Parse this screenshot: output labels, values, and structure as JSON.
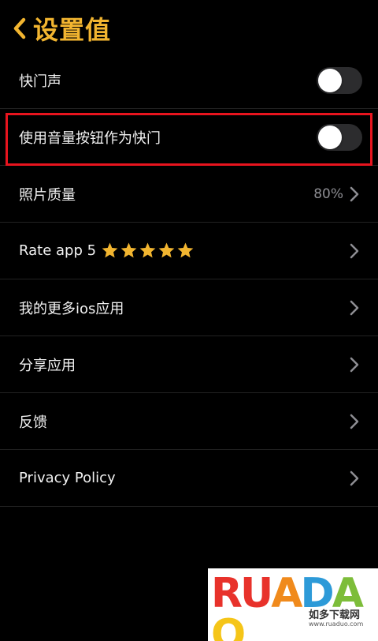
{
  "nav": {
    "title": "设置值",
    "accent_color": "#f2b530"
  },
  "settings": [
    {
      "label": "快门声",
      "control": "toggle",
      "on": false
    },
    {
      "label": "使用音量按钮作为快门",
      "control": "toggle",
      "on": false,
      "highlighted": true
    },
    {
      "label": "照片质量",
      "control": "chevron",
      "value": "80%"
    },
    {
      "label": "Rate app 5",
      "control": "chevron",
      "stars": 5
    },
    {
      "label": "我的更多ios应用",
      "control": "chevron"
    },
    {
      "label": "分享应用",
      "control": "chevron"
    },
    {
      "label": "反馈",
      "control": "chevron"
    },
    {
      "label": "Privacy Policy",
      "control": "chevron"
    }
  ],
  "highlight_color": "#e8141e",
  "watermark": {
    "letters": [
      "R",
      "U",
      "A",
      "D",
      "A",
      "O"
    ],
    "subtitle": "如多下载网",
    "url": "www.ruaduo.com"
  }
}
